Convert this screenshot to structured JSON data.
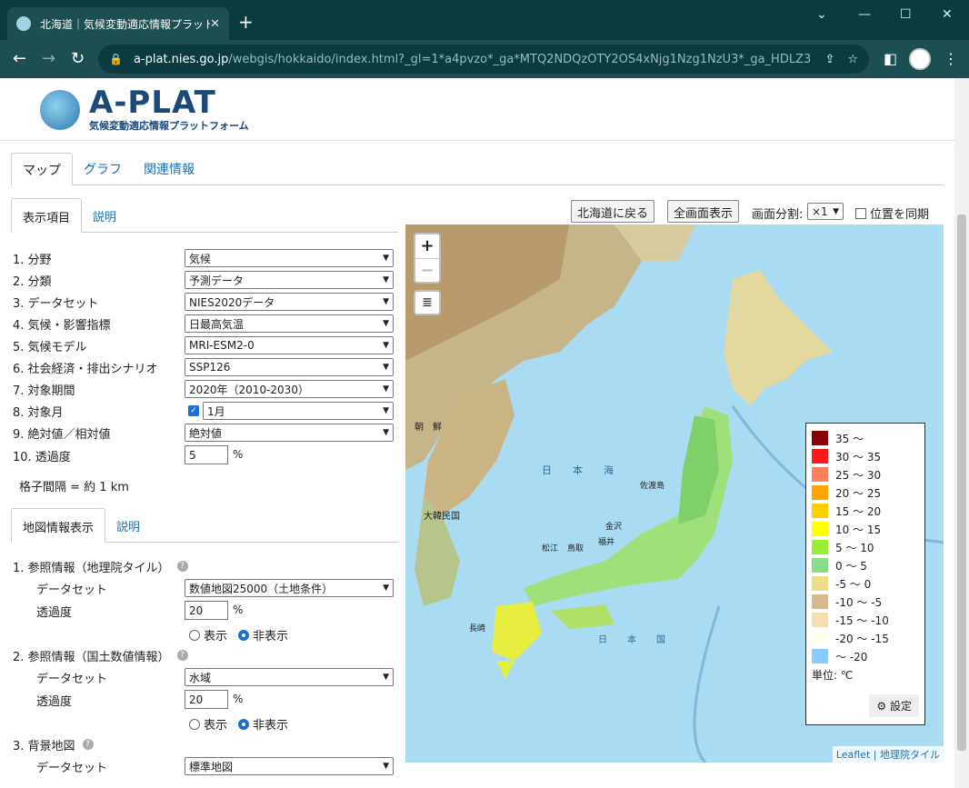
{
  "browser": {
    "tab_title": "北海道｜気候変動適応情報プラットフ",
    "url_host": "a-plat.nies.go.jp",
    "url_path": "/webgis/hokkaido/index.html?_gl=1*a4pvzo*_ga*MTQ2NDQzOTY2OS4xNjg1Nzg1NzU3*_ga_HDLZ3NG..."
  },
  "header": {
    "logo_title": "A-PLAT",
    "logo_subtitle": "気候変動適応情報プラットフォーム"
  },
  "main_tabs": [
    {
      "label": "マップ"
    },
    {
      "label": "グラフ"
    },
    {
      "label": "関連情報"
    }
  ],
  "display_tabs": [
    {
      "label": "表示項目"
    },
    {
      "label": "説明"
    }
  ],
  "fields": [
    {
      "label": "1. 分野",
      "value": "気候"
    },
    {
      "label": "2. 分類",
      "value": "予測データ"
    },
    {
      "label": "3. データセット",
      "value": "NIES2020データ"
    },
    {
      "label": "4. 気候・影響指標",
      "value": "日最高気温"
    },
    {
      "label": "5. 気候モデル",
      "value": "MRI-ESM2-0"
    },
    {
      "label": "6. 社会経済・排出シナリオ",
      "value": "SSP126"
    },
    {
      "label": "7. 対象期間",
      "value": "2020年（2010-2030）"
    },
    {
      "label": "8. 対象月",
      "value": "1月"
    },
    {
      "label": "9. 絶対値／相対値",
      "value": "絶対値"
    },
    {
      "label": "10. 透過度",
      "value": "5",
      "unit": "%"
    }
  ],
  "grid_note": "格子間隔 = 約 1 km",
  "mapinfo_tabs": [
    {
      "label": "地図情報表示"
    },
    {
      "label": "説明"
    }
  ],
  "ref1": {
    "title": "1. 参照情報（地理院タイル）",
    "ds_label": "データセット",
    "ds_value": "数値地図25000（土地条件）",
    "op_label": "透過度",
    "op_value": "20",
    "unit": "%",
    "show": "表示",
    "hide": "非表示"
  },
  "ref2": {
    "title": "2. 参照情報（国土数値情報）",
    "ds_label": "データセット",
    "ds_value": "水域",
    "op_label": "透過度",
    "op_value": "20",
    "unit": "%",
    "show": "表示",
    "hide": "非表示"
  },
  "ref3": {
    "title": "3. 背景地図",
    "ds_label": "データセット",
    "ds_value": "標準地図"
  },
  "map_toolbar": {
    "back": "北海道に戻る",
    "fullscreen": "全画面表示",
    "split_label": "画面分割:",
    "split_value": "×1",
    "sync": "位置を同期"
  },
  "legend": {
    "items": [
      {
        "label": "35 ～",
        "color": "#8b0000"
      },
      {
        "label": "30 ～ 35",
        "color": "#ff1a1a"
      },
      {
        "label": "25 ～ 30",
        "color": "#ff8060"
      },
      {
        "label": "20 ～ 25",
        "color": "#ffa500"
      },
      {
        "label": "15 ～ 20",
        "color": "#ffd000"
      },
      {
        "label": "10 ～ 15",
        "color": "#ffff00"
      },
      {
        "label": "5 ～ 10",
        "color": "#99ee33"
      },
      {
        "label": "0 ～ 5",
        "color": "#88dd88"
      },
      {
        "label": "-5 ～ 0",
        "color": "#eedd88"
      },
      {
        "label": "-10 ～ -5",
        "color": "#d9b98c"
      },
      {
        "label": "-15 ～ -10",
        "color": "#f5dfb0"
      },
      {
        "label": "-20 ～ -15",
        "color": "#fffff0"
      },
      {
        "label": "～ -20",
        "color": "#88ccff"
      }
    ],
    "unit": "単位: ℃",
    "settings": "設定"
  },
  "map_labels": {
    "sea_japan": "日　本　海",
    "korea": "大韓民国",
    "japan": "日　本　国",
    "chosen": "朝　鮮",
    "kanazawa": "金沢",
    "fukui": "福井",
    "tottori": "鳥取",
    "matsue": "松江",
    "nagasaki": "長崎",
    "sado": "佐渡島"
  },
  "attribution": {
    "leaflet": "Leaflet",
    "tiles": "地理院タイル"
  }
}
